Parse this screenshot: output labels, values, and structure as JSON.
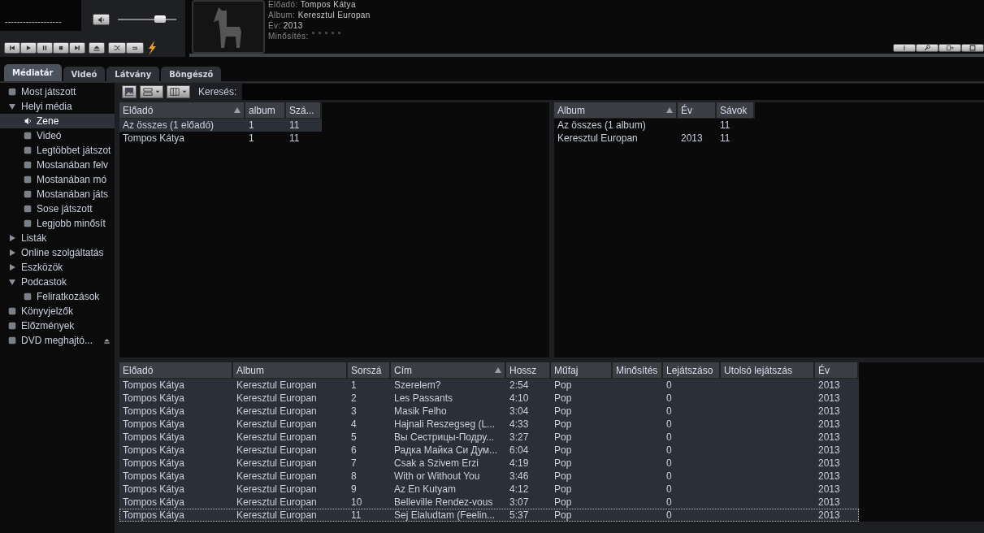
{
  "player": {
    "display_text": "-------------------",
    "volume": {
      "level": 0.72
    },
    "track_info": [
      {
        "label": "Előadó:",
        "value": "Tompos Kátya"
      },
      {
        "label": "Album:",
        "value": "Keresztul Europan"
      },
      {
        "label": "Év:",
        "value": "2013"
      }
    ],
    "rating": {
      "label": "Minősítés:",
      "stars": 0
    }
  },
  "tabs": [
    {
      "label": "Médiatár",
      "selected": true
    },
    {
      "label": "Videó",
      "selected": false
    },
    {
      "label": "Látvány",
      "selected": false
    },
    {
      "label": "Böngésző",
      "selected": false
    }
  ],
  "sidebar": {
    "items": [
      {
        "kind": "item",
        "label": "Most játszott",
        "selected": false
      },
      {
        "kind": "group",
        "label": "Helyi média",
        "expanded": true,
        "selected": false,
        "children": [
          {
            "kind": "item",
            "label": "Zene",
            "selected": true
          },
          {
            "kind": "item",
            "label": "Videó",
            "selected": false
          },
          {
            "kind": "item",
            "label": "Legtöbbet játszot",
            "selected": false
          },
          {
            "kind": "item",
            "label": "Mostanában felv",
            "selected": false
          },
          {
            "kind": "item",
            "label": "Mostanában mó",
            "selected": false
          },
          {
            "kind": "item",
            "label": "Mostanában játs",
            "selected": false
          },
          {
            "kind": "item",
            "label": "Sose játszott",
            "selected": false
          },
          {
            "kind": "item",
            "label": "Legjobb minősít",
            "selected": false
          }
        ]
      },
      {
        "kind": "group",
        "label": "Listák",
        "expanded": false,
        "selected": false
      },
      {
        "kind": "group",
        "label": "Online szolgáltatás",
        "expanded": false,
        "selected": false
      },
      {
        "kind": "group",
        "label": "Eszközök",
        "expanded": false,
        "selected": false
      },
      {
        "kind": "group",
        "label": "Podcastok",
        "expanded": true,
        "selected": false,
        "children": [
          {
            "kind": "item",
            "label": "Feliratkozások",
            "selected": false
          }
        ]
      },
      {
        "kind": "item",
        "label": "Könyvjelzők",
        "selected": false
      },
      {
        "kind": "item",
        "label": "Előzmények",
        "selected": false
      },
      {
        "kind": "item",
        "label": "DVD meghajtó...",
        "selected": false
      }
    ]
  },
  "search": {
    "label": "Keresés:"
  },
  "artist_table": {
    "columns": [
      {
        "label": "Előadó",
        "sorted": true
      },
      {
        "label": "album",
        "sorted": false
      },
      {
        "label": "Szá...",
        "sorted": false
      }
    ],
    "rows": [
      {
        "cells": [
          "Az összes (1 előadó)",
          "1",
          "11"
        ],
        "selected": true,
        "focused": false
      },
      {
        "cells": [
          "Tompos Kátya",
          "1",
          "11"
        ],
        "selected": false,
        "focused": false
      }
    ]
  },
  "album_table": {
    "columns": [
      {
        "label": "Album",
        "sorted": true
      },
      {
        "label": "Év",
        "sorted": false
      },
      {
        "label": "Sávok",
        "sorted": false
      }
    ],
    "rows": [
      {
        "cells": [
          "Az összes (1 album)",
          "",
          "11"
        ],
        "selected": false,
        "focused": false
      },
      {
        "cells": [
          "Keresztul Europan",
          "2013",
          "11"
        ],
        "selected": false,
        "focused": false
      }
    ]
  },
  "track_table": {
    "columns": [
      {
        "label": "Előadó",
        "sorted": false
      },
      {
        "label": "Album",
        "sorted": false
      },
      {
        "label": "Sorszá",
        "sorted": false
      },
      {
        "label": "Cím",
        "sorted": true
      },
      {
        "label": "Hossz",
        "sorted": false
      },
      {
        "label": "Műfaj",
        "sorted": false
      },
      {
        "label": "Minősítés",
        "sorted": false
      },
      {
        "label": "Lejátszáso",
        "sorted": false
      },
      {
        "label": "Utolsó lejátszás",
        "sorted": false
      },
      {
        "label": "Év",
        "sorted": false
      }
    ],
    "rows": [
      {
        "cells": [
          "Tompos Kátya",
          "Keresztul Europan",
          "1",
          "Szerelem?",
          "2:54",
          "Pop",
          "",
          "0",
          "",
          "2013"
        ],
        "selected": true,
        "focused": false
      },
      {
        "cells": [
          "Tompos Kátya",
          "Keresztul Europan",
          "2",
          "Les Passants",
          "4:10",
          "Pop",
          "",
          "0",
          "",
          "2013"
        ],
        "selected": true,
        "focused": false
      },
      {
        "cells": [
          "Tompos Kátya",
          "Keresztul Europan",
          "3",
          "Masik Felho",
          "3:04",
          "Pop",
          "",
          "0",
          "",
          "2013"
        ],
        "selected": true,
        "focused": false
      },
      {
        "cells": [
          "Tompos Kátya",
          "Keresztul Europan",
          "4",
          "Hajnali Reszegseg (L...",
          "4:33",
          "Pop",
          "",
          "0",
          "",
          "2013"
        ],
        "selected": true,
        "focused": false
      },
      {
        "cells": [
          "Tompos Kátya",
          "Keresztul Europan",
          "5",
          "Вы Сестрицы-Подру...",
          "3:27",
          "Pop",
          "",
          "0",
          "",
          "2013"
        ],
        "selected": true,
        "focused": false
      },
      {
        "cells": [
          "Tompos Kátya",
          "Keresztul Europan",
          "6",
          "Радка Майка Си Дум...",
          "6:04",
          "Pop",
          "",
          "0",
          "",
          "2013"
        ],
        "selected": true,
        "focused": false
      },
      {
        "cells": [
          "Tompos Kátya",
          "Keresztul Europan",
          "7",
          "Csak a Szivem Erzi",
          "4:19",
          "Pop",
          "",
          "0",
          "",
          "2013"
        ],
        "selected": true,
        "focused": false
      },
      {
        "cells": [
          "Tompos Kátya",
          "Keresztul Europan",
          "8",
          "With or Without You",
          "3:46",
          "Pop",
          "",
          "0",
          "",
          "2013"
        ],
        "selected": true,
        "focused": false
      },
      {
        "cells": [
          "Tompos Kátya",
          "Keresztul Europan",
          "9",
          "Az En Kutyam",
          "4:12",
          "Pop",
          "",
          "0",
          "",
          "2013"
        ],
        "selected": true,
        "focused": false
      },
      {
        "cells": [
          "Tompos Kátya",
          "Keresztul Europan",
          "10",
          "Belleville Rendez-vous",
          "3:07",
          "Pop",
          "",
          "0",
          "",
          "2013"
        ],
        "selected": true,
        "focused": false
      },
      {
        "cells": [
          "Tompos Kátya",
          "Keresztul Europan",
          "11",
          "Sej Elaludtam (Feelin...",
          "5:37",
          "Pop",
          "",
          "0",
          "",
          "2013"
        ],
        "selected": true,
        "focused": true
      }
    ]
  }
}
